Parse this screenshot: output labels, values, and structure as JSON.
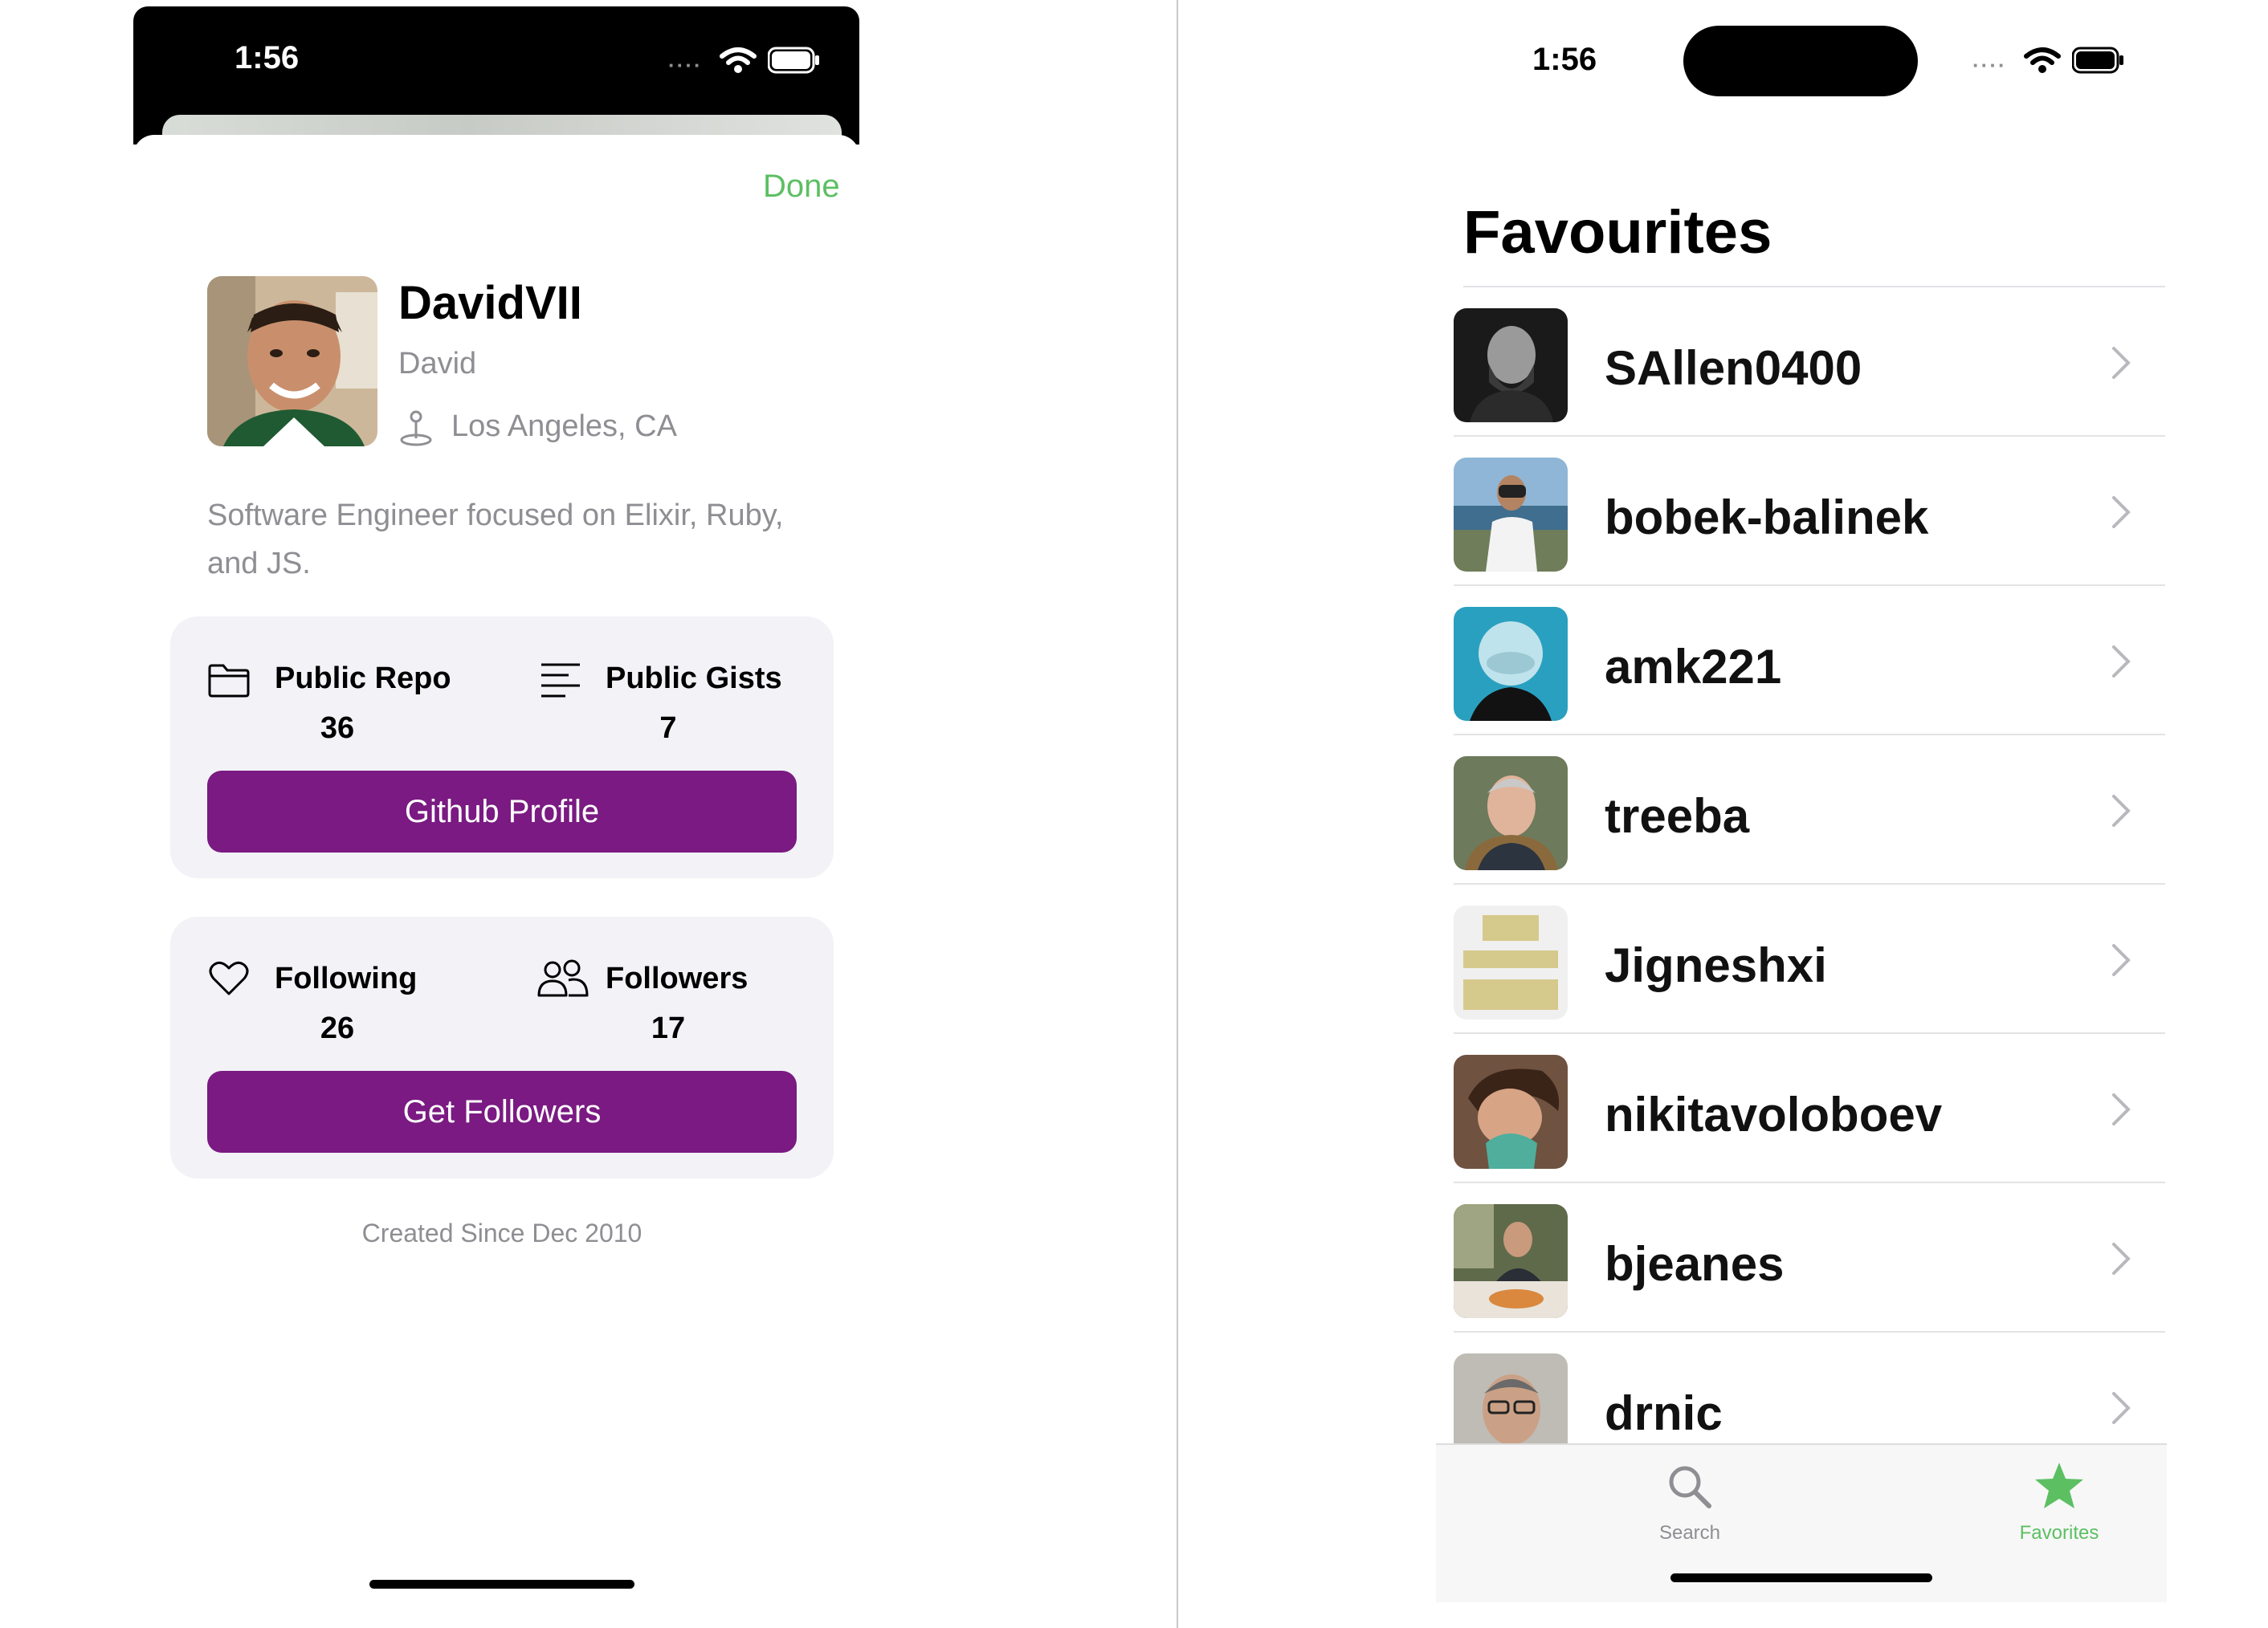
{
  "status_bar": {
    "time": "1:56",
    "signal_dots": "····",
    "icons": [
      "wifi-icon",
      "battery-icon"
    ]
  },
  "profile_sheet": {
    "done_label": "Done",
    "username": "DavidVII",
    "real_name": "David",
    "location": "Los Angeles, CA",
    "bio": "Software Engineer focused on Elixir, Ruby, and JS.",
    "repo_card": {
      "public_repo_label": "Public Repo",
      "public_repo_count": "36",
      "public_gists_label": "Public Gists",
      "public_gists_count": "7",
      "button_label": "Github Profile"
    },
    "follow_card": {
      "following_label": "Following",
      "following_count": "26",
      "followers_label": "Followers",
      "followers_count": "17",
      "button_label": "Get Followers"
    },
    "created_since": "Created Since Dec 2010",
    "colors": {
      "accent": "#5cbf62",
      "button": "#7a1a82",
      "card": "#f2f2f7",
      "secondary_text": "#8e8e93"
    }
  },
  "favorites": {
    "title": "Favourites",
    "items": [
      {
        "name": "SAllen0400"
      },
      {
        "name": "bobek-balinek"
      },
      {
        "name": "amk221"
      },
      {
        "name": "treeba"
      },
      {
        "name": "Jigneshxi"
      },
      {
        "name": "nikitavoloboev"
      },
      {
        "name": "bjeanes"
      },
      {
        "name": "drnic"
      }
    ]
  },
  "tab_bar": {
    "tabs": [
      {
        "label": "Search",
        "icon": "magnifying-glass-icon",
        "selected": false
      },
      {
        "label": "Favorites",
        "icon": "star-icon",
        "selected": true
      }
    ],
    "selected_color": "#5cbf62",
    "unselected_color": "#8e8e93"
  }
}
